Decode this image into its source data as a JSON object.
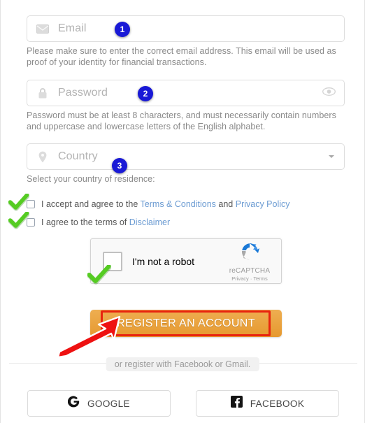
{
  "fields": {
    "email": {
      "placeholder": "Email",
      "icon": "envelope-icon",
      "badge": "1",
      "helper": "Please make sure to enter the correct email address. This email will be used as proof of your identity for financial transactions."
    },
    "password": {
      "placeholder": "Password",
      "icon": "lock-icon",
      "badge": "2",
      "helper": "Password must be at least 8 characters, and must necessarily contain numbers and uppercase and lowercase letters of the English alphabet.",
      "toggle_icon": "eye-icon"
    },
    "country": {
      "placeholder": "Country",
      "icon": "location-pin-icon",
      "badge": "3",
      "helper": "Select your country of residence:",
      "caret_icon": "chevron-down-icon"
    }
  },
  "agreements": [
    {
      "prefix": "I accept and agree to the ",
      "link1": "Terms & Conditions",
      "middle": " and ",
      "link2": "Privacy Policy",
      "checked": false,
      "annotation": "green-check"
    },
    {
      "prefix": "I agree to the terms of ",
      "link1": "Disclaimer",
      "middle": "",
      "link2": "",
      "checked": false,
      "annotation": "green-check"
    }
  ],
  "recaptcha": {
    "label": "I'm not a robot",
    "brand": "reCAPTCHA",
    "privacy": "Privacy",
    "separator": "·",
    "terms": "Terms",
    "checked": false,
    "annotation": "green-check"
  },
  "register": {
    "label": "REGISTER AN ACCOUNT",
    "color": "#e6992f",
    "annotation_color": "#e8240f",
    "arrow": "red-arrow"
  },
  "divider": {
    "text": "or register with Facebook or Gmail."
  },
  "social": [
    {
      "label": "GOOGLE",
      "icon": "google-icon"
    },
    {
      "label": "FACEBOOK",
      "icon": "facebook-icon"
    }
  ],
  "colors": {
    "badge": "#1919d6",
    "link": "#6b9bd2",
    "check": "#52c41a"
  }
}
